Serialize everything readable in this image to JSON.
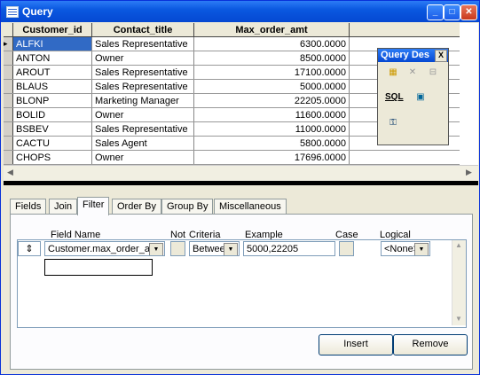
{
  "window": {
    "title": "Query"
  },
  "grid": {
    "columns": [
      "Customer_id",
      "Contact_title",
      "Max_order_amt"
    ],
    "rows": [
      [
        "ALFKI",
        "Sales Representative",
        "6300.0000"
      ],
      [
        "ANTON",
        "Owner",
        "8500.0000"
      ],
      [
        "AROUT",
        "Sales Representative",
        "17100.0000"
      ],
      [
        "BLAUS",
        "Sales Representative",
        "5000.0000"
      ],
      [
        "BLONP",
        "Marketing Manager",
        "22205.0000"
      ],
      [
        "BOLID",
        "Owner",
        "11600.0000"
      ],
      [
        "BSBEV",
        "Sales Representative",
        "11000.0000"
      ],
      [
        "CACTU",
        "Sales Agent",
        "5800.0000"
      ],
      [
        "CHOPS",
        "Owner",
        "17696.0000"
      ]
    ]
  },
  "query_designer": {
    "title": "Query Des",
    "close": "X",
    "sql_label": "SQL",
    "icons": [
      "add-table-icon",
      "delete-icon",
      "join-icon",
      "sql-icon",
      "view-icon",
      "keys-icon"
    ]
  },
  "tabs": [
    "Fields",
    "Join",
    "Filter",
    "Order By",
    "Group By",
    "Miscellaneous"
  ],
  "active_tab": "Filter",
  "filter": {
    "headers": {
      "field_name": "Field Name",
      "not": "Not",
      "criteria": "Criteria",
      "example": "Example",
      "case": "Case",
      "logical": "Logical"
    },
    "row": {
      "field_name": "Customer.max_order_amt",
      "criteria": "Between",
      "example": "5000,22205",
      "logical": "<None>"
    }
  },
  "buttons": {
    "insert": "Insert",
    "remove": "Remove"
  },
  "colors": {
    "title_bar": "#0548d2",
    "selection": "#316ac5"
  }
}
